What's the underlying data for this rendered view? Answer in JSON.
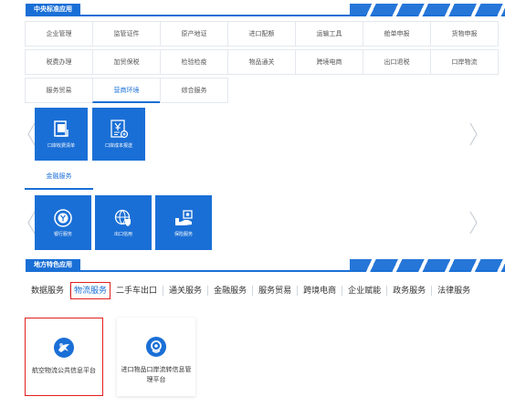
{
  "central": {
    "title": "中央标准应用",
    "rows": [
      [
        "企业管理",
        "监管证件",
        "原产地证",
        "进口配额",
        "运输工具",
        "舱单申报",
        "货物申报"
      ],
      [
        "税费办理",
        "加贸保税",
        "检验检疫",
        "物品通关",
        "跨境电商",
        "出口退税",
        "口岸物流"
      ],
      [
        "服务贸易",
        "营商环境",
        "综合服务"
      ]
    ],
    "active_item": "营商环境",
    "tiles_a": [
      {
        "label": "口岸收费清单",
        "icon": "document-list-icon"
      },
      {
        "label": "口岸成本报送",
        "icon": "yuan-report-icon"
      }
    ],
    "sub_tab": "金融服务",
    "tiles_b": [
      {
        "label": "银行服务",
        "icon": "bank-icon"
      },
      {
        "label": "出口信用",
        "icon": "globe-shield-icon"
      },
      {
        "label": "保险服务",
        "icon": "insurance-icon"
      }
    ]
  },
  "local": {
    "title": "地方特色应用",
    "tabs": [
      "数据服务",
      "物流服务",
      "二手车出口",
      "通关服务",
      "金融服务",
      "服务贸易",
      "跨境电商",
      "企业赋能",
      "政务服务",
      "法律服务"
    ],
    "active_tab": "物流服务",
    "cards": [
      {
        "label": "航空物流公共信息平台",
        "icon": "globe-plane-icon"
      },
      {
        "label": "进口物品口岸流转信息管理平台",
        "icon": "location-pin-icon"
      }
    ]
  },
  "colors": {
    "brand_blue": "#1a6fd6",
    "highlight_red": "#e02020"
  }
}
